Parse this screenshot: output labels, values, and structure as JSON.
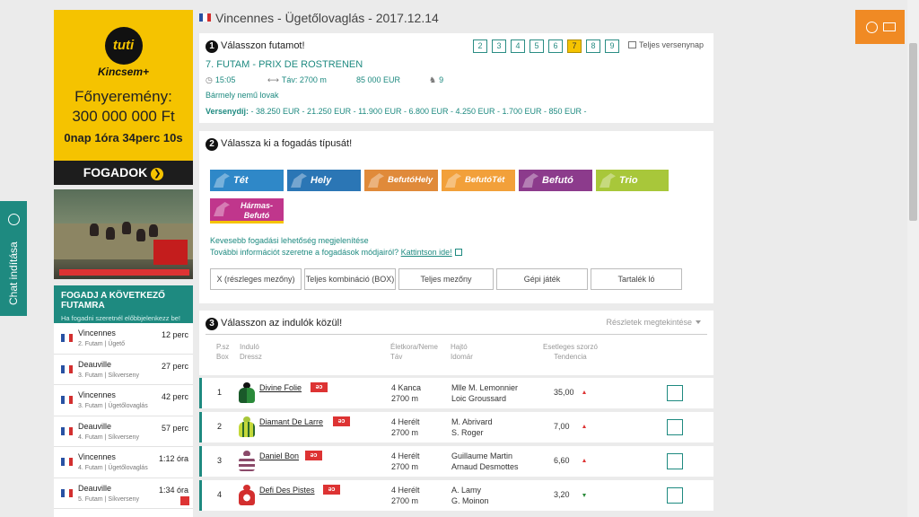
{
  "header": {
    "title": "Vincennes - Ügetőlovaglás - 2017.12.14"
  },
  "promo": {
    "logo": "tuti",
    "brand": "Kincsem+",
    "prize_label": "Főnyeremény:",
    "prize_value": "300 000 000 Ft",
    "countdown": "0nap 1óra 34perc 10s",
    "bet_button": "FOGADOK",
    "bet_arrow": "❯"
  },
  "next_races": {
    "title": "FOGADJ A KÖVETKEZŐ FUTAMRA",
    "subtitle": "Ha fogadni szeretnél előbbjelenkezz be!",
    "items": [
      {
        "name": "Vincennes",
        "sub": "2. Futam | Ügető",
        "time": "12 perc"
      },
      {
        "name": "Deauville",
        "sub": "3. Futam | Síkverseny",
        "time": "27 perc"
      },
      {
        "name": "Vincennes",
        "sub": "3. Futam | Ügetőlovaglás",
        "time": "42 perc"
      },
      {
        "name": "Deauville",
        "sub": "4. Futam | Síkverseny",
        "time": "57 perc"
      },
      {
        "name": "Vincennes",
        "sub": "4. Futam | Ügetőlovaglás",
        "time": "1:12 óra"
      },
      {
        "name": "Deauville",
        "sub": "5. Futam | Síkverseny",
        "time": "1:34 óra"
      }
    ]
  },
  "chat": {
    "label": "Chat indítása"
  },
  "step1": {
    "num": "1",
    "heading": "Válasszon futamot!",
    "race_numbers": [
      "2",
      "3",
      "4",
      "5",
      "6",
      "7",
      "8",
      "9"
    ],
    "active_race": "7",
    "full_day": "Teljes versenynap",
    "race_title": "7. FUTAM - PRIX DE ROSTRENEN",
    "time": "15:05",
    "distance": "Táv: 2700 m",
    "prize": "85 000 EUR",
    "runners": "9",
    "race_type": "Bármely nemű lovak",
    "prize_label": "Versenydíj:",
    "prize_breakdown": " - 38.250 EUR - 21.250 EUR - 11.900 EUR - 6.800 EUR - 4.250 EUR - 1.700 EUR - 850 EUR -"
  },
  "step2": {
    "num": "2",
    "heading": "Válassza ki a fogadás típusát!",
    "bet_types": {
      "tet": "Tét",
      "hely": "Hely",
      "befuto_hely": "BefutóHely",
      "befuto_tet": "BefutóTét",
      "befuto": "Befutó",
      "trio": "Trio",
      "harmas_line1": "Hármas-",
      "harmas_line2": "Befutó"
    },
    "fewer_link": "Kevesebb fogadási lehetőség megjelenítése",
    "more_info_text": "További információt szeretne a fogadások módjairól?",
    "more_info_link": "Kattintson ide!",
    "modes": [
      "X (részleges mezőny)",
      "Teljes kombináció (BOX)",
      "Teljes mezőny",
      "Gépi játék",
      "Tartalék ló"
    ]
  },
  "step3": {
    "num": "3",
    "heading": "Válasszon az indulók közül!",
    "details_toggle": "Részletek megtekintése",
    "headers": {
      "psz": "P.sz",
      "box": "Box",
      "horse": "Induló",
      "dress": "Dressz",
      "age_sex": "Életkora/Neme",
      "distance": "Táv",
      "jockey": "Hajtó",
      "trainer": "Idomár",
      "odds": "Esetleges szorzó",
      "trend": "Tendencia"
    }
  },
  "runners": [
    {
      "num": "1",
      "name": "Divine Folie",
      "tag": "ǝɔ",
      "age": "4 Kanca",
      "dist": "2700 m",
      "jockey": "Mlle M. Lemonnier",
      "trainer": "Loic Groussard",
      "odds": "35,00",
      "trend": "up"
    },
    {
      "num": "2",
      "name": "Diamant De Larre",
      "tag": "ǝɔ",
      "age": "4 Herélt",
      "dist": "2700 m",
      "jockey": "M. Abrivard",
      "trainer": "S. Roger",
      "odds": "7,00",
      "trend": "up"
    },
    {
      "num": "3",
      "name": "Daniel Bon",
      "tag": "ǝɔ",
      "age": "4 Herélt",
      "dist": "2700 m",
      "jockey": "Guillaume Martin",
      "trainer": "Arnaud Desmottes",
      "odds": "6,60",
      "trend": "up"
    },
    {
      "num": "4",
      "name": "Defi Des Pistes",
      "tag": "ǝɔ",
      "age": "4 Herélt",
      "dist": "2700 m",
      "jockey": "A. Lamy",
      "trainer": "G. Moinon",
      "odds": "3,20",
      "trend": "down"
    }
  ],
  "colors": {
    "teal": "#1e8a80",
    "yellow": "#f5c300",
    "orange": "#f08a24"
  }
}
